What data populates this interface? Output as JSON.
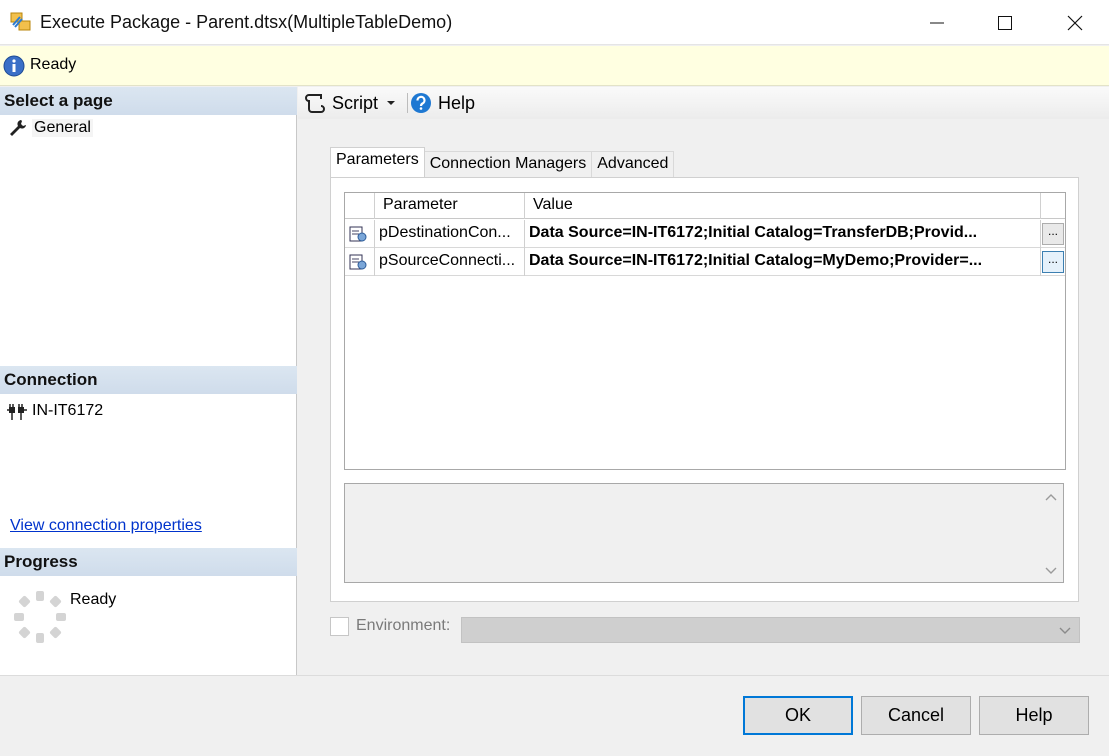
{
  "window": {
    "title": "Execute Package - Parent.dtsx(MultipleTableDemo)"
  },
  "status": {
    "text": "Ready"
  },
  "left": {
    "select_page_header": "Select a page",
    "pages": [
      {
        "label": "General"
      }
    ],
    "connection_header": "Connection",
    "server": "IN-IT6172",
    "view_connection_link": "View connection properties",
    "progress_header": "Progress",
    "progress_status": "Ready"
  },
  "toolbar": {
    "script_label": "Script",
    "help_label": "Help"
  },
  "tabs": [
    {
      "label": "Parameters"
    },
    {
      "label": "Connection Managers"
    },
    {
      "label": "Advanced"
    }
  ],
  "grid": {
    "columns": [
      "Parameter",
      "Value"
    ],
    "rows": [
      {
        "parameter": "pDestinationCon...",
        "value": "Data Source=IN-IT6172;Initial Catalog=TransferDB;Provid...",
        "button": "..."
      },
      {
        "parameter": "pSourceConnecti...",
        "value": "Data Source=IN-IT6172;Initial Catalog=MyDemo;Provider=...",
        "button": "..."
      }
    ]
  },
  "environment": {
    "label": "Environment:",
    "selected": ""
  },
  "buttons": {
    "ok": "OK",
    "cancel": "Cancel",
    "help": "Help"
  },
  "colors": {
    "status_bar": "#ffffe1",
    "section_header": "#dbe6f1",
    "link": "#0033cc",
    "default_button_border": "#0078d7",
    "help_icon": "#1e78d2"
  }
}
